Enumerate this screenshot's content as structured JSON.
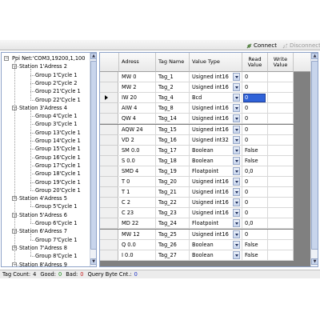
{
  "toolbar": {
    "connect_label": "Connect",
    "disconnect_label": "Disconnect"
  },
  "tree": {
    "root": "Ppi Net:'COM3,19200,1,100",
    "stations": [
      {
        "label": "Station 1'Adress 2",
        "groups": [
          "Group 1'Cycle 1",
          "Group 2'Cycle 2",
          "Group 21'Cycle 1",
          "Group 22'Cycle 1"
        ]
      },
      {
        "label": "Station 3'Adress 4",
        "groups": [
          "Group 4'Cycle 1",
          "Group 3'Cycle 1",
          "Group 13'Cycle 1",
          "Group 14'Cycle 1",
          "Group 15'Cycle 1",
          "Group 16'Cycle 1",
          "Group 17'Cycle 1",
          "Group 18'Cycle 1",
          "Group 19'Cycle 1",
          "Group 20'Cycle 1"
        ]
      },
      {
        "label": "Station 4'Adress 5",
        "groups": [
          "Group 5'Cycle 1"
        ]
      },
      {
        "label": "Station 5'Adress 6",
        "groups": [
          "Group 6'Cycle 1"
        ]
      },
      {
        "label": "Station 6'Adress 7",
        "groups": [
          "Group 7'Cycle 1"
        ]
      },
      {
        "label": "Station 7'Adress 8",
        "groups": [
          "Group 8'Cycle 1"
        ]
      },
      {
        "label": "Station 8'Adress 9",
        "groups": []
      }
    ]
  },
  "grid": {
    "headers": {
      "adress": "Adress",
      "tag_name": "Tag Name",
      "value_type": "Value Type",
      "read_value": "Read Value",
      "write_value": "Write Value"
    },
    "rows": [
      {
        "adress": "MW 0",
        "tag": "Tag_1",
        "type": "Usigned int16",
        "read": "0",
        "write": ""
      },
      {
        "adress": "MW 2",
        "tag": "Tag_2",
        "type": "Usigned int16",
        "read": "0",
        "write": ""
      },
      {
        "adress": "IW 20",
        "tag": "Tag_4",
        "type": "Bcd",
        "read": "0",
        "write": ""
      },
      {
        "adress": "AIW 4",
        "tag": "Tag_8",
        "type": "Usigned int16",
        "read": "0",
        "write": ""
      },
      {
        "adress": "QW 4",
        "tag": "Tag_14",
        "type": "Usigned int16",
        "read": "0",
        "write": ""
      },
      {
        "adress": "AQW 24",
        "tag": "Tag_15",
        "type": "Usigned int16",
        "read": "0",
        "write": ""
      },
      {
        "adress": "VD 2",
        "tag": "Tag_16",
        "type": "Usigned int32",
        "read": "0",
        "write": ""
      },
      {
        "adress": "SM 0.0",
        "tag": "Tag_17",
        "type": "Boolean",
        "read": "False",
        "write": ""
      },
      {
        "adress": "S 0.0",
        "tag": "Tag_18",
        "type": "Boolean",
        "read": "False",
        "write": ""
      },
      {
        "adress": "SMD 4",
        "tag": "Tag_19",
        "type": "Floatpoint",
        "read": "0,0",
        "write": ""
      },
      {
        "adress": "T 0",
        "tag": "Tag_20",
        "type": "Usigned int16",
        "read": "0",
        "write": ""
      },
      {
        "adress": "T 1",
        "tag": "Tag_21",
        "type": "Usigned int16",
        "read": "0",
        "write": ""
      },
      {
        "adress": "C 2",
        "tag": "Tag_22",
        "type": "Usigned int16",
        "read": "0",
        "write": ""
      },
      {
        "adress": "C 23",
        "tag": "Tag_23",
        "type": "Usigned int16",
        "read": "0",
        "write": ""
      },
      {
        "adress": "MD 22",
        "tag": "Tag_24",
        "type": "Floatpoint",
        "read": "0,0",
        "write": ""
      },
      {
        "adress": "MW 12",
        "tag": "Tag_25",
        "type": "Usigned int16",
        "read": "0",
        "write": ""
      },
      {
        "adress": "Q 0.0",
        "tag": "Tag_26",
        "type": "Boolean",
        "read": "False",
        "write": ""
      },
      {
        "adress": "I 0.0",
        "tag": "Tag_27",
        "type": "Boolean",
        "read": "False",
        "write": ""
      }
    ],
    "selected_row": 2
  },
  "status": {
    "tag_count_label": "Tag Count:",
    "tag_count": "4",
    "good_label": "Good:",
    "good": "0",
    "bad_label": "Bad:",
    "bad": "0",
    "query_label": "Query Byte Cnt.:",
    "query": "0"
  },
  "colors": {
    "active_cell": "#2f62d8",
    "good": "#138a13",
    "bad": "#c21818",
    "query": "#1a2ec4"
  }
}
